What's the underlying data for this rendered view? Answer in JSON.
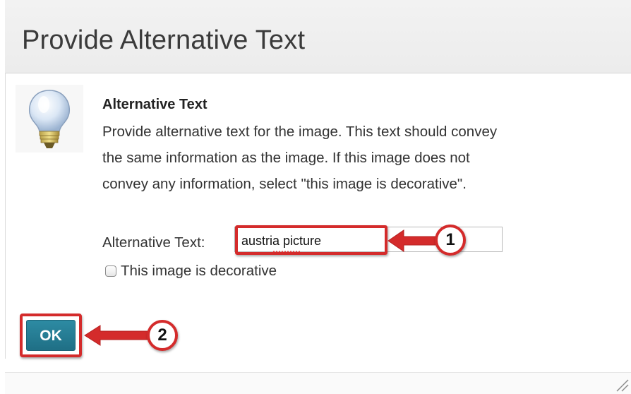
{
  "dialog": {
    "title": "Provide Alternative Text"
  },
  "section": {
    "heading": "Alternative Text",
    "description_lines": [
      "Provide alternative text for the image. This text should convey",
      "the same information as the image. If this image does not",
      "convey any information, select \"this image is decorative\"."
    ]
  },
  "form": {
    "alt_label": "Alternative Text:",
    "alt_value": "austria picture",
    "decorative_label": "This image is decorative",
    "decorative_checked": false
  },
  "actions": {
    "ok_label": "OK"
  },
  "annotations": {
    "callout_1": "1",
    "callout_2": "2",
    "color": "#d42b2b"
  },
  "colors": {
    "ok_button": "#2d8ba3",
    "title_bar": "#eeeeee"
  },
  "icons": {
    "section_icon": "lightbulb-icon",
    "resize": "resize-grip-icon"
  }
}
